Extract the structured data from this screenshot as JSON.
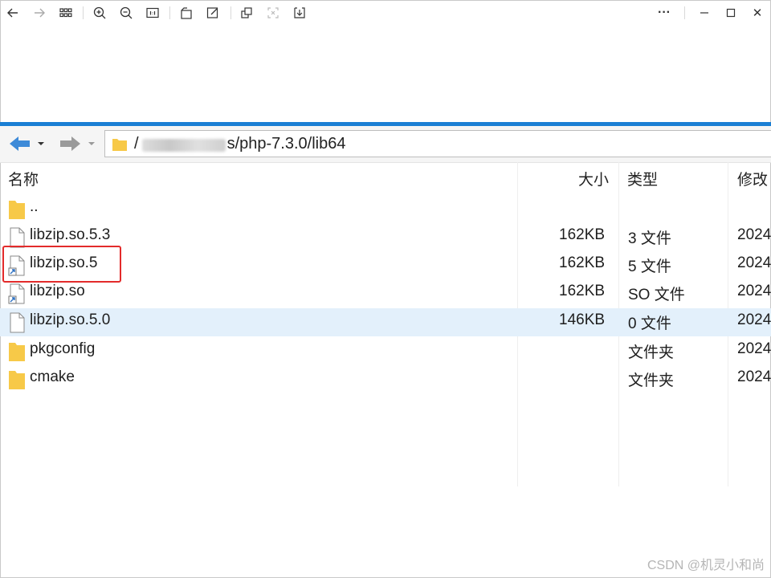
{
  "viewer": {
    "toolbar_icons": [
      "back-arrow-icon",
      "forward-arrow-icon",
      "grid-icon",
      "zoom-in-icon",
      "zoom-out-icon",
      "actual-size-icon",
      "rotate-icon",
      "edit-icon",
      "copy-icon",
      "fit-icon",
      "download-icon",
      "more-icon",
      "minimize-icon",
      "maximize-icon",
      "close-icon"
    ],
    "close_glyph": "✕",
    "more_glyph": "···"
  },
  "file_manager": {
    "path_prefix": "/",
    "path_suffix": "s/php-7.3.0/lib64",
    "columns": {
      "name": "名称",
      "size": "大小",
      "type": "类型",
      "modified": "修改"
    },
    "rows": [
      {
        "name": "..",
        "size": "",
        "type": "",
        "modified": "",
        "icon": "folder-icon"
      },
      {
        "name": "libzip.so.5.3",
        "size": "162KB",
        "type": "3 文件",
        "modified": "2024",
        "icon": "file-icon"
      },
      {
        "name": "libzip.so.5",
        "size": "162KB",
        "type": "5 文件",
        "modified": "2024",
        "icon": "symlink-file-icon"
      },
      {
        "name": "libzip.so",
        "size": "162KB",
        "type": "SO 文件",
        "modified": "2024",
        "icon": "symlink-file-icon"
      },
      {
        "name": "libzip.so.5.0",
        "size": "146KB",
        "type": "0 文件",
        "modified": "2024",
        "icon": "file-icon"
      },
      {
        "name": "pkgconfig",
        "size": "",
        "type": "文件夹",
        "modified": "2024",
        "icon": "folder-icon"
      },
      {
        "name": "cmake",
        "size": "",
        "type": "文件夹",
        "modified": "2024",
        "icon": "folder-icon"
      }
    ],
    "selected_row": 4,
    "highlighted_row": 2
  },
  "watermark": "CSDN @机灵小和尚",
  "colors": {
    "accent_blue": "#1a7fd4",
    "selection": "#e3f0fb",
    "highlight_red": "#e32b2b",
    "folder_yellow": "#f7c948"
  }
}
